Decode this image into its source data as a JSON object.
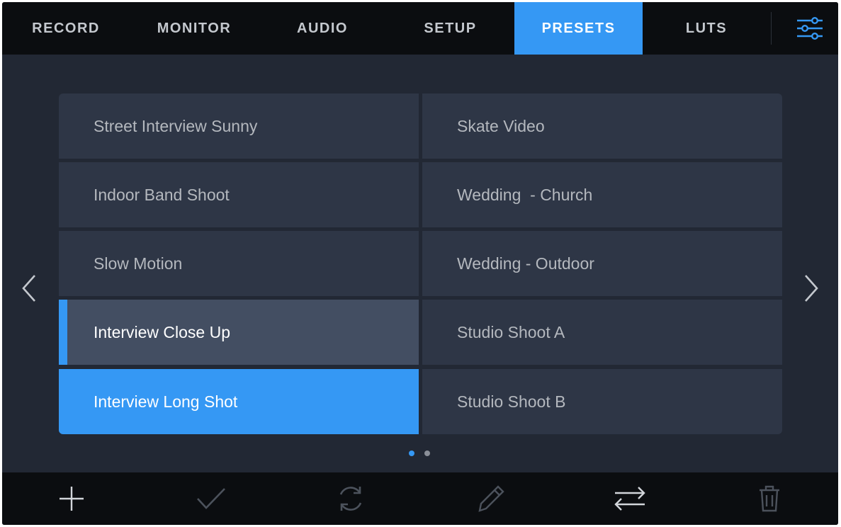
{
  "tabs": [
    {
      "label": "RECORD",
      "active": false
    },
    {
      "label": "MONITOR",
      "active": false
    },
    {
      "label": "AUDIO",
      "active": false
    },
    {
      "label": "SETUP",
      "active": false
    },
    {
      "label": "PRESETS",
      "active": true
    },
    {
      "label": "LUTS",
      "active": false
    }
  ],
  "settings_icon": "sliders-icon",
  "presets": {
    "left": [
      {
        "label": "Street Interview Sunny",
        "state": "normal"
      },
      {
        "label": "Indoor Band Shoot",
        "state": "normal"
      },
      {
        "label": "Slow Motion",
        "state": "normal"
      },
      {
        "label": "Interview Close Up",
        "state": "loaded"
      },
      {
        "label": "Interview Long Shot",
        "state": "selected"
      }
    ],
    "right": [
      {
        "label": "Skate Video",
        "state": "normal"
      },
      {
        "label": "Wedding  - Church",
        "state": "normal"
      },
      {
        "label": "Wedding - Outdoor",
        "state": "normal"
      },
      {
        "label": "Studio Shoot A",
        "state": "normal"
      },
      {
        "label": "Studio Shoot B",
        "state": "normal"
      }
    ]
  },
  "pagination": {
    "current": 1,
    "total": 2
  },
  "toolbar": {
    "icons": [
      "plus-icon",
      "checkmark-icon",
      "refresh-icon",
      "pencil-icon",
      "swap-arrows-icon",
      "trash-icon"
    ]
  },
  "colors": {
    "accent": "#3598f4",
    "background": "#222834",
    "bar": "#0b0d10",
    "cell": "#2e3646",
    "cell_loaded": "#434e62",
    "text": "#b4b8be"
  }
}
